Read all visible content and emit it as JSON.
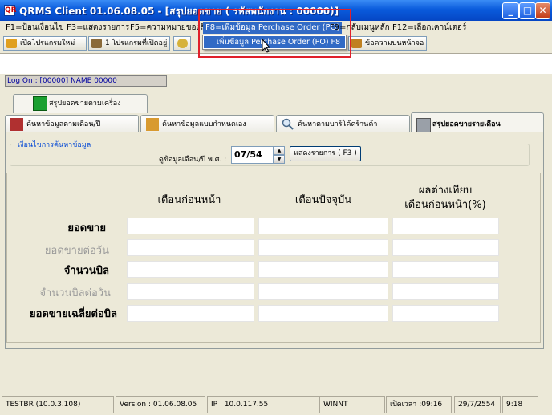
{
  "window": {
    "title": "QRMS Client 01.06.08.05 - [สรุปยอดขาย ( รหัสพนักงาน : 00000)]",
    "app_icon": "QR",
    "buttons": {
      "minimize": "_",
      "maximize": "□",
      "close": "✕"
    }
  },
  "menubar": [
    "F1=ป้อนเงื่อนไข",
    "F3=แสดงรายการ",
    "F5=ความหมายของสี",
    "F8=เพิ่มข้อมูล Perchase Order (PO)",
    "F9=กลับเมนูหลัก",
    "F12=เลือกเคาน์เตอร์"
  ],
  "dropdown": {
    "item": "เพิ่มข้อมูล Perchase Order (PO)  F8"
  },
  "toolbar": {
    "open_new": "เปิดโปรแกรมใหม่",
    "open_programs": "1 โปรแกรมที่เปิดอยู่",
    "message": "ข้อความบนหน้าจอ"
  },
  "logon": "Log On : [00000] NAME 00000",
  "tabs_top": [
    "สรุปยอดขายตามเครื่อง"
  ],
  "tabs_main": [
    "ค้นหาข้อมูลตามเดือน/ปี",
    "ค้นหาข้อมูลแบบกำหนดเอง",
    "ค้นหาตามบาร์โค้ดร้านค้า",
    "สรุปยอดขายรายเดือน"
  ],
  "search": {
    "group_title": "เงื่อนไขการค้นหาข้อมูล",
    "period_label": "ดูข้อมูลเดือน/ปี พ.ศ. :",
    "period_value": "07/54",
    "show_button": "แสดงรายการ ( F3 )"
  },
  "summary": {
    "columns": [
      "เดือนก่อนหน้า",
      "เดือนปัจจุบัน",
      "ผลต่างเทียบ\nเดือนก่อนหน้า(%)"
    ],
    "column_line1": "ผลต่างเทียบ",
    "column_line2": "เดือนก่อนหน้า(%)",
    "rows": [
      "ยอดขาย",
      "ยอดขายต่อวัน",
      "จำนวนบิล",
      "จำนวนบิลต่อวัน",
      "ยอดขายเฉลี่ยต่อบิล"
    ]
  },
  "statusbar": {
    "host": "TESTBR (10.0.3.108)",
    "version": "Version : 01.06.08.05",
    "ip": "IP : 10.0.117.55",
    "os": "WINNT",
    "open_time": "เปิดเวลา :09:16",
    "date": "29/7/2554",
    "time": "9:18"
  },
  "colors": {
    "title_bar": "#0a5bdc",
    "menu_highlight": "#316ac5",
    "annotation_box": "#e0202a",
    "group_title": "#0046d5"
  },
  "icons": [
    "app-icon",
    "open-program-icon",
    "programs-icon",
    "arrow-icon",
    "message-icon",
    "report-icon",
    "calendar-icon",
    "people-icon",
    "search-icon",
    "summary-icon",
    "cursor-icon"
  ]
}
